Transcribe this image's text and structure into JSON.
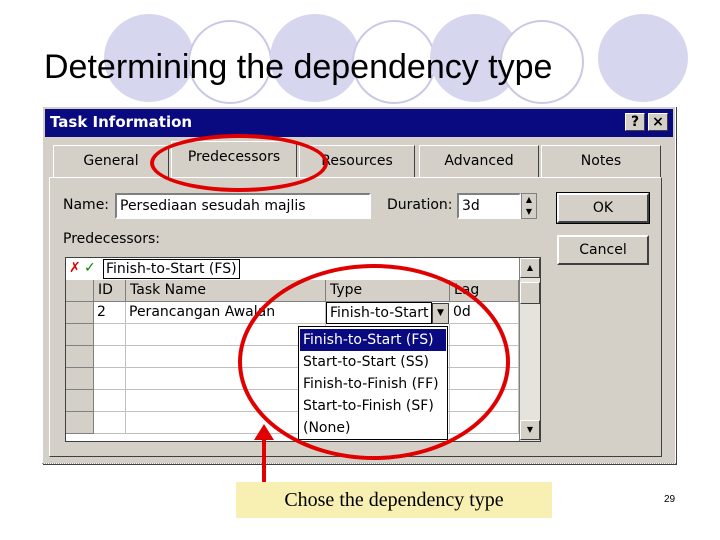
{
  "slide": {
    "title": "Determining the dependency type",
    "caption": "Chose the dependency type",
    "slide_number": "29"
  },
  "dialog": {
    "title": "Task Information",
    "help_label": "?",
    "close_label": "×",
    "tabs": [
      {
        "label": "General"
      },
      {
        "label": "Predecessors"
      },
      {
        "label": "Resources"
      },
      {
        "label": "Advanced"
      },
      {
        "label": "Notes"
      }
    ],
    "name_label": "Name:",
    "name_value": "Persediaan  sesudah majlis",
    "duration_label": "Duration:",
    "duration_value": "3d",
    "predecessors_label": "Predecessors:",
    "ok_label": "OK",
    "cancel_label": "Cancel"
  },
  "grid": {
    "edit_value": "Finish-to-Start (FS)",
    "columns": [
      "ID",
      "Task Name",
      "Type",
      "Lag"
    ],
    "rows": [
      {
        "id": "2",
        "task_name": "Perancangan Awalan",
        "type": "Finish-to-Start (FS)",
        "lag": "0d"
      }
    ]
  },
  "dropdown": {
    "options": [
      "Finish-to-Start (FS)",
      "Start-to-Start (SS)",
      "Finish-to-Finish (FF)",
      "Start-to-Finish (SF)",
      "(None)"
    ],
    "selected_index": 0
  },
  "icons": {
    "cancel_edit": "x-mark-icon",
    "accept_edit": "check-mark-icon",
    "combo_arrow": "chevron-down-icon"
  },
  "colors": {
    "title_bar": "#0a0a80",
    "annotation_red": "#e00000",
    "caption_bg": "#f8efb2",
    "decor_circles": "#d6d6ee"
  }
}
